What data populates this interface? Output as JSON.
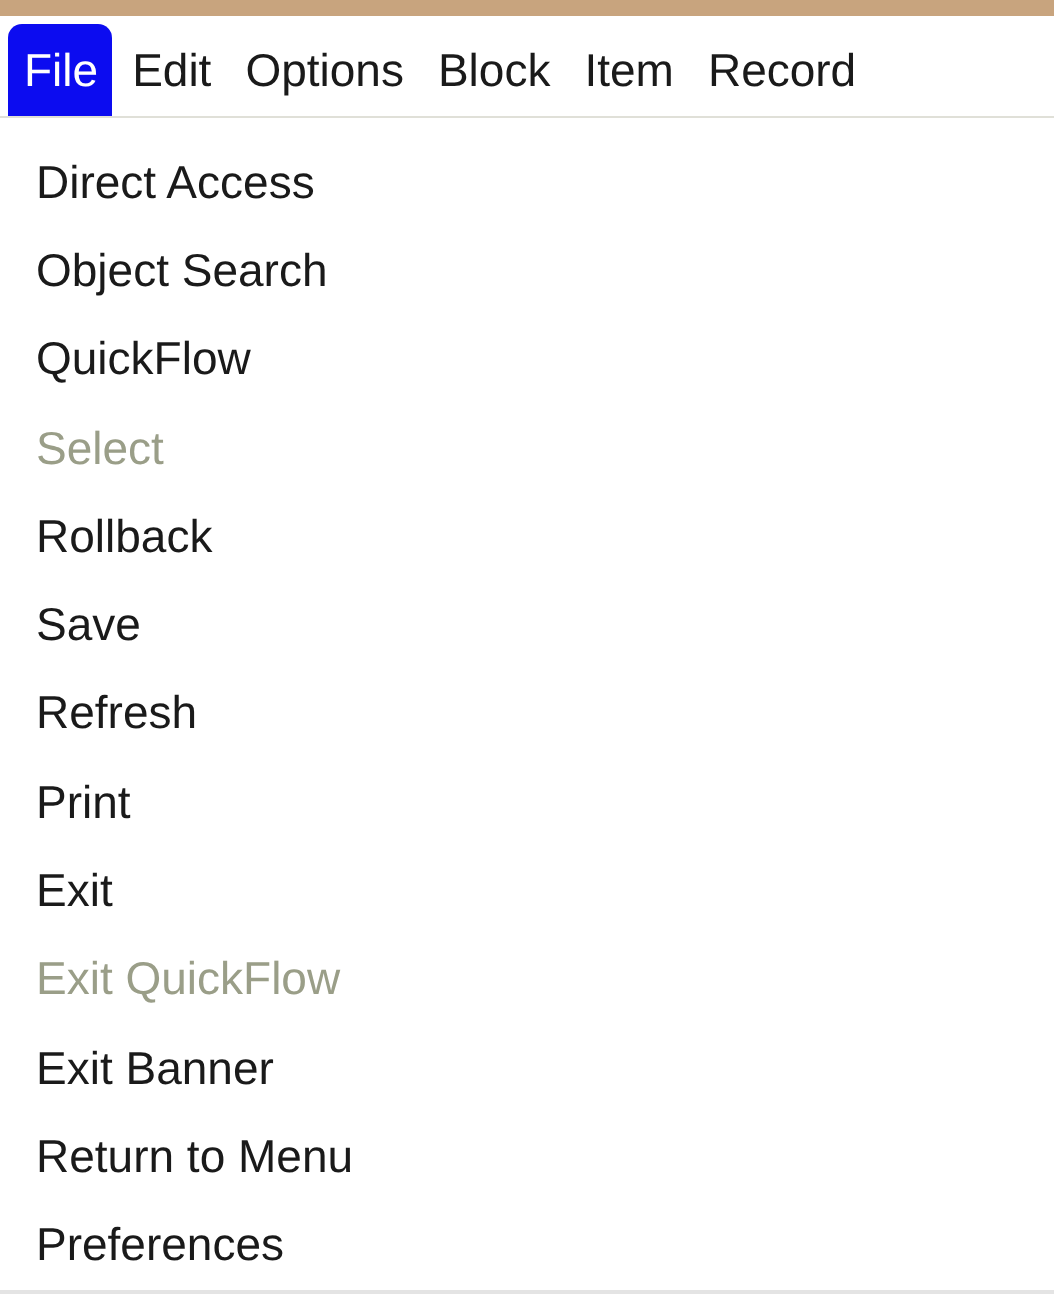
{
  "menu_bar": [
    {
      "label": "File",
      "selected": true
    },
    {
      "label": "Edit",
      "selected": false
    },
    {
      "label": "Options",
      "selected": false
    },
    {
      "label": "Block",
      "selected": false
    },
    {
      "label": "Item",
      "selected": false
    },
    {
      "label": "Record",
      "selected": false
    }
  ],
  "file_menu": [
    {
      "label": "Direct Access",
      "disabled": false
    },
    {
      "label": "Object Search",
      "disabled": false
    },
    {
      "label": "QuickFlow",
      "disabled": false
    },
    {
      "label": "Select",
      "disabled": true
    },
    {
      "label": "Rollback",
      "disabled": false
    },
    {
      "label": "Save",
      "disabled": false
    },
    {
      "label": "Refresh",
      "disabled": false
    },
    {
      "label": "Print",
      "disabled": false
    },
    {
      "label": "Exit",
      "disabled": false
    },
    {
      "label": "Exit QuickFlow",
      "disabled": true
    },
    {
      "label": "Exit Banner",
      "disabled": false
    },
    {
      "label": "Return to Menu",
      "disabled": false
    },
    {
      "label": "Preferences",
      "disabled": false
    }
  ]
}
